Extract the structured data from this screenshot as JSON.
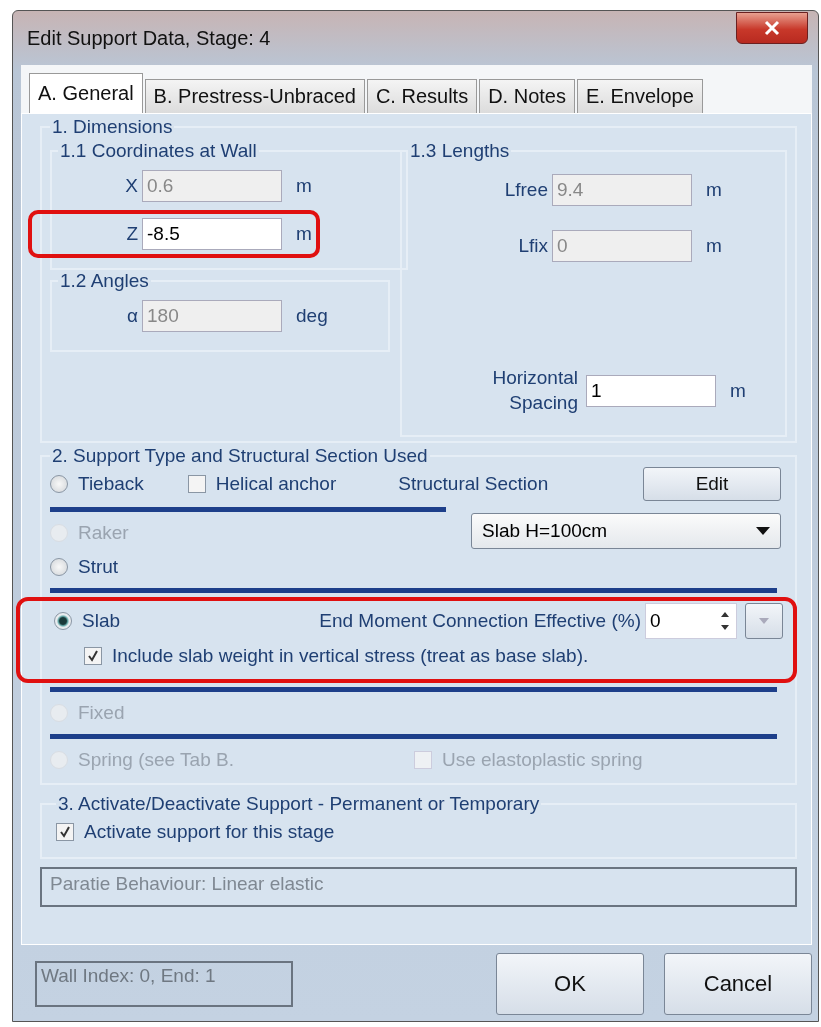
{
  "window": {
    "title": "Edit Support Data, Stage: 4"
  },
  "tabs": [
    {
      "label": "A. General",
      "selected": true
    },
    {
      "label": "B. Prestress-Unbraced",
      "selected": false
    },
    {
      "label": "C. Results",
      "selected": false
    },
    {
      "label": "D. Notes",
      "selected": false
    },
    {
      "label": "E. Envelope",
      "selected": false
    }
  ],
  "dimensions": {
    "title": "1. Dimensions",
    "coordinates": {
      "title": "1.1 Coordinates at Wall",
      "fields": [
        {
          "label": "X",
          "value": "0.6",
          "unit": "m",
          "disabled": true
        },
        {
          "label": "Z",
          "value": "-8.5",
          "unit": "m",
          "disabled": false,
          "highlighted": true
        }
      ]
    },
    "angles": {
      "title": "1.2 Angles",
      "fields": [
        {
          "label": "α",
          "value": "180",
          "unit": "deg",
          "disabled": true
        }
      ]
    },
    "lengths": {
      "title": "1.3 Lengths",
      "fields": [
        {
          "label": "Lfree",
          "value": "9.4",
          "unit": "m",
          "disabled": true
        },
        {
          "label": "Lfix",
          "value": "0",
          "unit": "m",
          "disabled": true
        }
      ]
    },
    "spacing": {
      "label": "Horizontal Spacing",
      "value": "1",
      "unit": "m",
      "disabled": false
    }
  },
  "support_type": {
    "title": "2. Support Type and Structural Section Used",
    "options": [
      {
        "label": "Tieback",
        "selected": false,
        "disabled": false
      },
      {
        "label": "Raker",
        "selected": false,
        "disabled": true
      },
      {
        "label": "Strut",
        "selected": false,
        "disabled": false
      },
      {
        "label": "Slab",
        "selected": true,
        "disabled": false
      },
      {
        "label": "Fixed",
        "selected": false,
        "disabled": true
      },
      {
        "label": "Spring (see Tab B.",
        "selected": false,
        "disabled": true
      }
    ],
    "helical_anchor": {
      "label": "Helical anchor",
      "checked": false,
      "disabled": false
    },
    "structural_section": {
      "label": "Structural Section",
      "button": "Edit",
      "value": "Slab H=100cm"
    },
    "end_moment": {
      "label": "End Moment Connection Effective (%)",
      "value": "0"
    },
    "slab_weight": {
      "label": "Include slab weight in vertical stress (treat as base slab).",
      "checked": true,
      "disabled": false
    },
    "slab_highlighted": true,
    "elastoplastic": {
      "label": "Use elastoplastic spring",
      "checked": false,
      "disabled": true
    }
  },
  "activation": {
    "title": "3. Activate/Deactivate Support - Permanent or Temporary",
    "checkbox": {
      "label": "Activate support for this stage",
      "checked": true,
      "disabled": false
    }
  },
  "behaviour": "Paratie Behaviour: Linear elastic",
  "status": "Wall Index:  0, End: 1",
  "buttons": [
    "OK",
    "Cancel"
  ]
}
